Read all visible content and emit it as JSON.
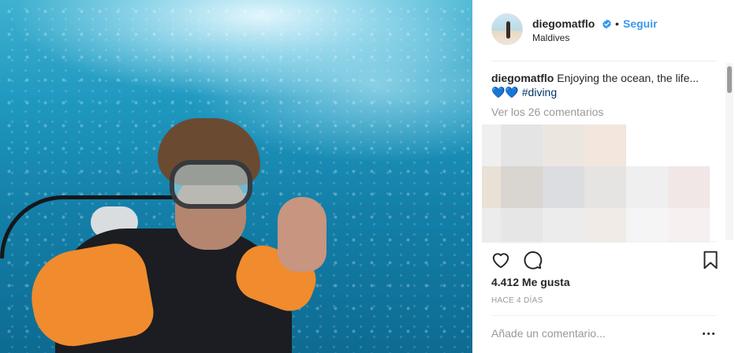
{
  "post": {
    "photo_alt": "Scuba diver underwater selfie",
    "user": {
      "username": "diegomatflo",
      "verified": true,
      "location": "Maldives",
      "separator": "•",
      "follow_label": "Seguir"
    },
    "caption": {
      "username": "diegomatflo",
      "text": "Enjoying the ocean, the life...",
      "emoji": "💙💙",
      "hashtag": "#diving"
    },
    "view_comments_label": "Ver los 26 comentarios",
    "likes_label": "4.412 Me gusta",
    "time_label": "HACE 4 DÍAS",
    "comment_placeholder": "Añade un comentario..."
  },
  "icons": {
    "verified": "verified-badge-icon",
    "like": "heart-icon",
    "comment": "comment-bubble-icon",
    "save": "bookmark-icon",
    "more": "more-options-icon"
  },
  "colors": {
    "link_blue": "#3897f0",
    "hashtag": "#003569",
    "muted": "#999999",
    "text": "#262626"
  }
}
